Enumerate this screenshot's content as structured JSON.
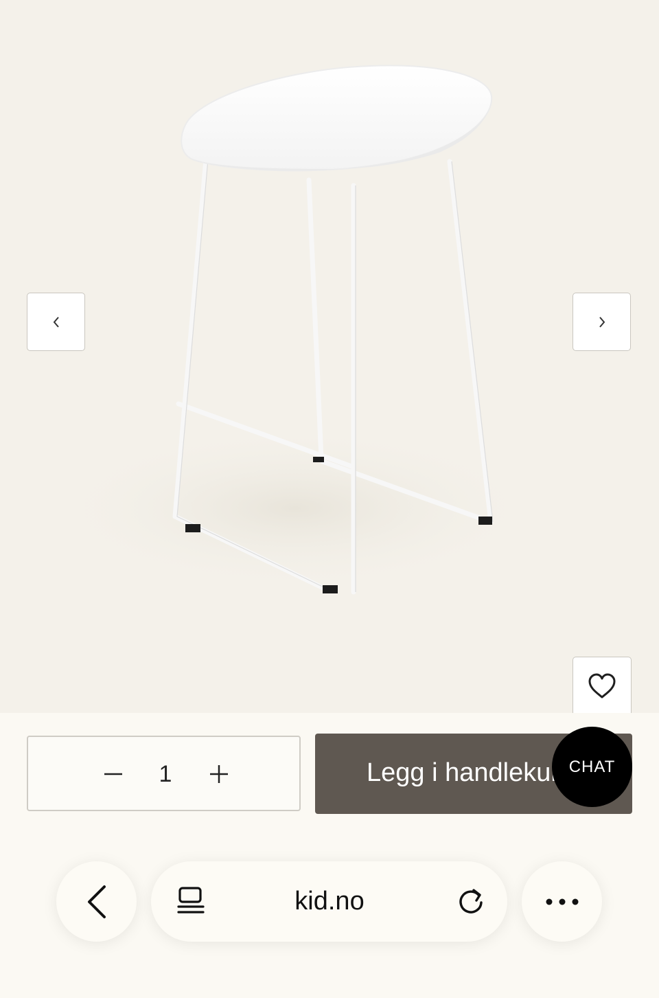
{
  "gallery": {
    "image_alt": "White bar stool with sled base",
    "prev_icon": "chevron-left-icon",
    "next_icon": "chevron-right-icon",
    "favorite_icon": "heart-icon"
  },
  "purchase": {
    "quantity": "1",
    "decrement_icon": "minus-icon",
    "increment_icon": "plus-icon",
    "add_to_cart_label": "Legg i handlekurv"
  },
  "chat": {
    "label": "CHAT"
  },
  "browser": {
    "url": "kid.no",
    "back_icon": "back-arrow-icon",
    "tabs_icon": "tabs-icon",
    "reload_icon": "reload-icon",
    "more_icon": "more-options-icon"
  },
  "colors": {
    "page_bg": "#fbf9f3",
    "image_bg": "#f4f1ea",
    "cart_button": "#5f5851",
    "chat_button": "#000000"
  }
}
